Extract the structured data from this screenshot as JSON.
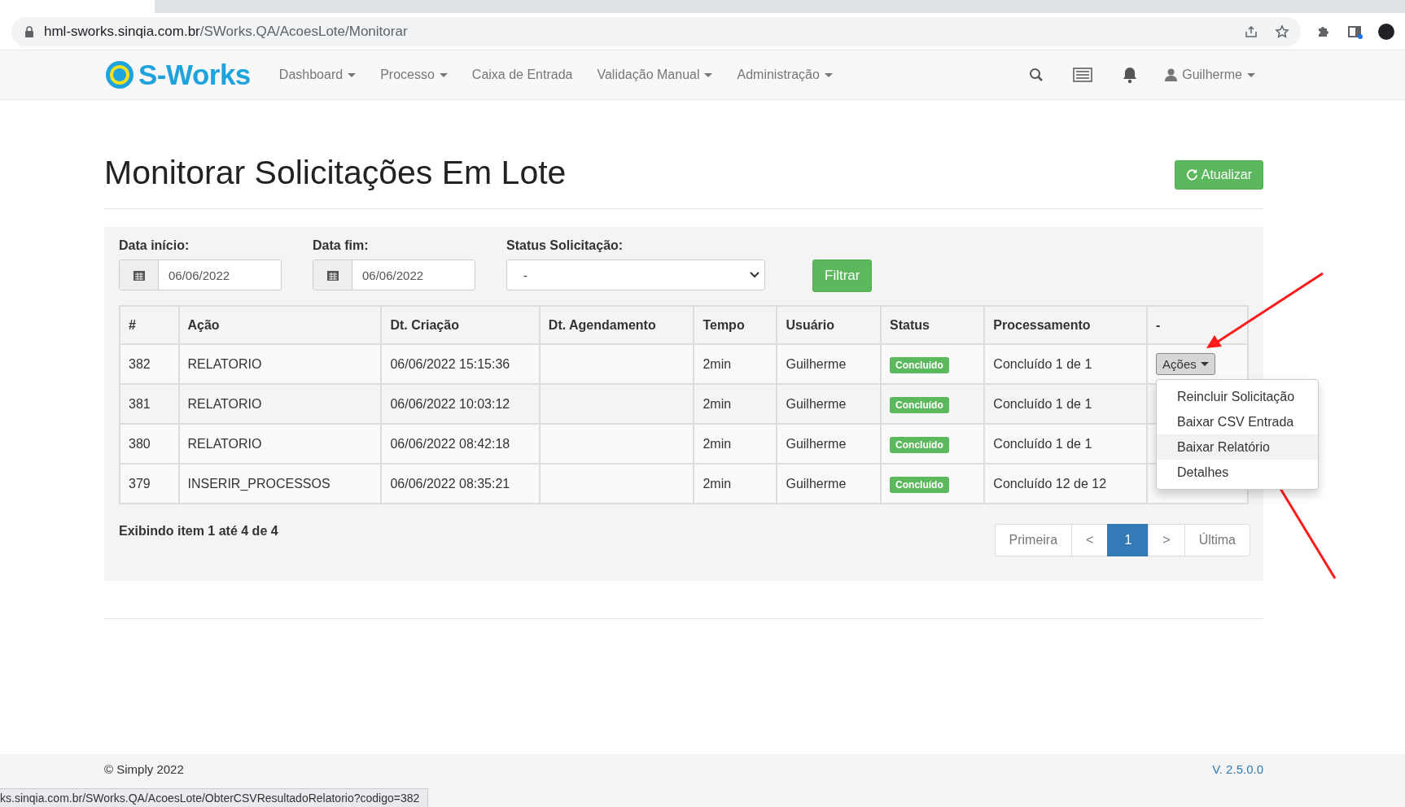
{
  "browser": {
    "url_domain": "hml-sworks.sinqia.com.br",
    "url_path": "/SWorks.QA/AcoesLote/Monitorar"
  },
  "navbar": {
    "logo": "S-Works",
    "menu": [
      {
        "label": "Dashboard",
        "dropdown": true
      },
      {
        "label": "Processo",
        "dropdown": true
      },
      {
        "label": "Caixa de Entrada",
        "dropdown": false
      },
      {
        "label": "Validação Manual",
        "dropdown": true
      },
      {
        "label": "Administração",
        "dropdown": true
      }
    ],
    "user": "Guilherme"
  },
  "page": {
    "title": "Monitorar Solicitações Em Lote",
    "refresh_button": "Atualizar"
  },
  "filters": {
    "start_label": "Data início:",
    "start_value": "06/06/2022",
    "end_label": "Data fim:",
    "end_value": "06/06/2022",
    "status_label": "Status Solicitação:",
    "status_value": "-",
    "filter_button": "Filtrar"
  },
  "table": {
    "columns": [
      "#",
      "Ação",
      "Dt. Criação",
      "Dt. Agendamento",
      "Tempo",
      "Usuário",
      "Status",
      "Processamento",
      "-"
    ],
    "rows": [
      {
        "id": "382",
        "action": "RELATORIO",
        "created": "06/06/2022 15:15:36",
        "time": "2min",
        "user": "Guilherme",
        "status": "Concluído",
        "processing": "Concluído 1 de 1"
      },
      {
        "id": "381",
        "action": "RELATORIO",
        "created": "06/06/2022 10:03:12",
        "time": "2min",
        "user": "Guilherme",
        "status": "Concluído",
        "processing": "Concluído 1 de 1"
      },
      {
        "id": "380",
        "action": "RELATORIO",
        "created": "06/06/2022 08:42:18",
        "time": "2min",
        "user": "Guilherme",
        "status": "Concluído",
        "processing": "Concluído 1 de 1"
      },
      {
        "id": "379",
        "action": "INSERIR_PROCESSOS",
        "created": "06/06/2022 08:35:21",
        "time": "2min",
        "user": "Guilherme",
        "status": "Concluído",
        "processing": "Concluído 12 de 12"
      }
    ],
    "actions_button": "Ações"
  },
  "action_menu": [
    {
      "label": "Reincluir Solicitação",
      "selected": false
    },
    {
      "label": "Baixar CSV Entrada",
      "selected": false
    },
    {
      "label": "Baixar Relatório",
      "selected": true
    },
    {
      "label": "Detalhes",
      "selected": false
    }
  ],
  "summary": "Exibindo item 1 até 4 de 4",
  "pagination": [
    {
      "label": "Primeira",
      "selected": false
    },
    {
      "label": "<",
      "selected": false
    },
    {
      "label": "1",
      "selected": true
    },
    {
      "label": ">",
      "selected": false
    },
    {
      "label": "Última",
      "selected": false
    }
  ],
  "footer": {
    "copyright": "© Simply 2022",
    "version": "V. 2.5.0.0"
  },
  "status_bar": "ks.sinqia.com.br/SWorks.QA/AcoesLote/ObterCSVResultadoRelatorio?codigo=382"
}
